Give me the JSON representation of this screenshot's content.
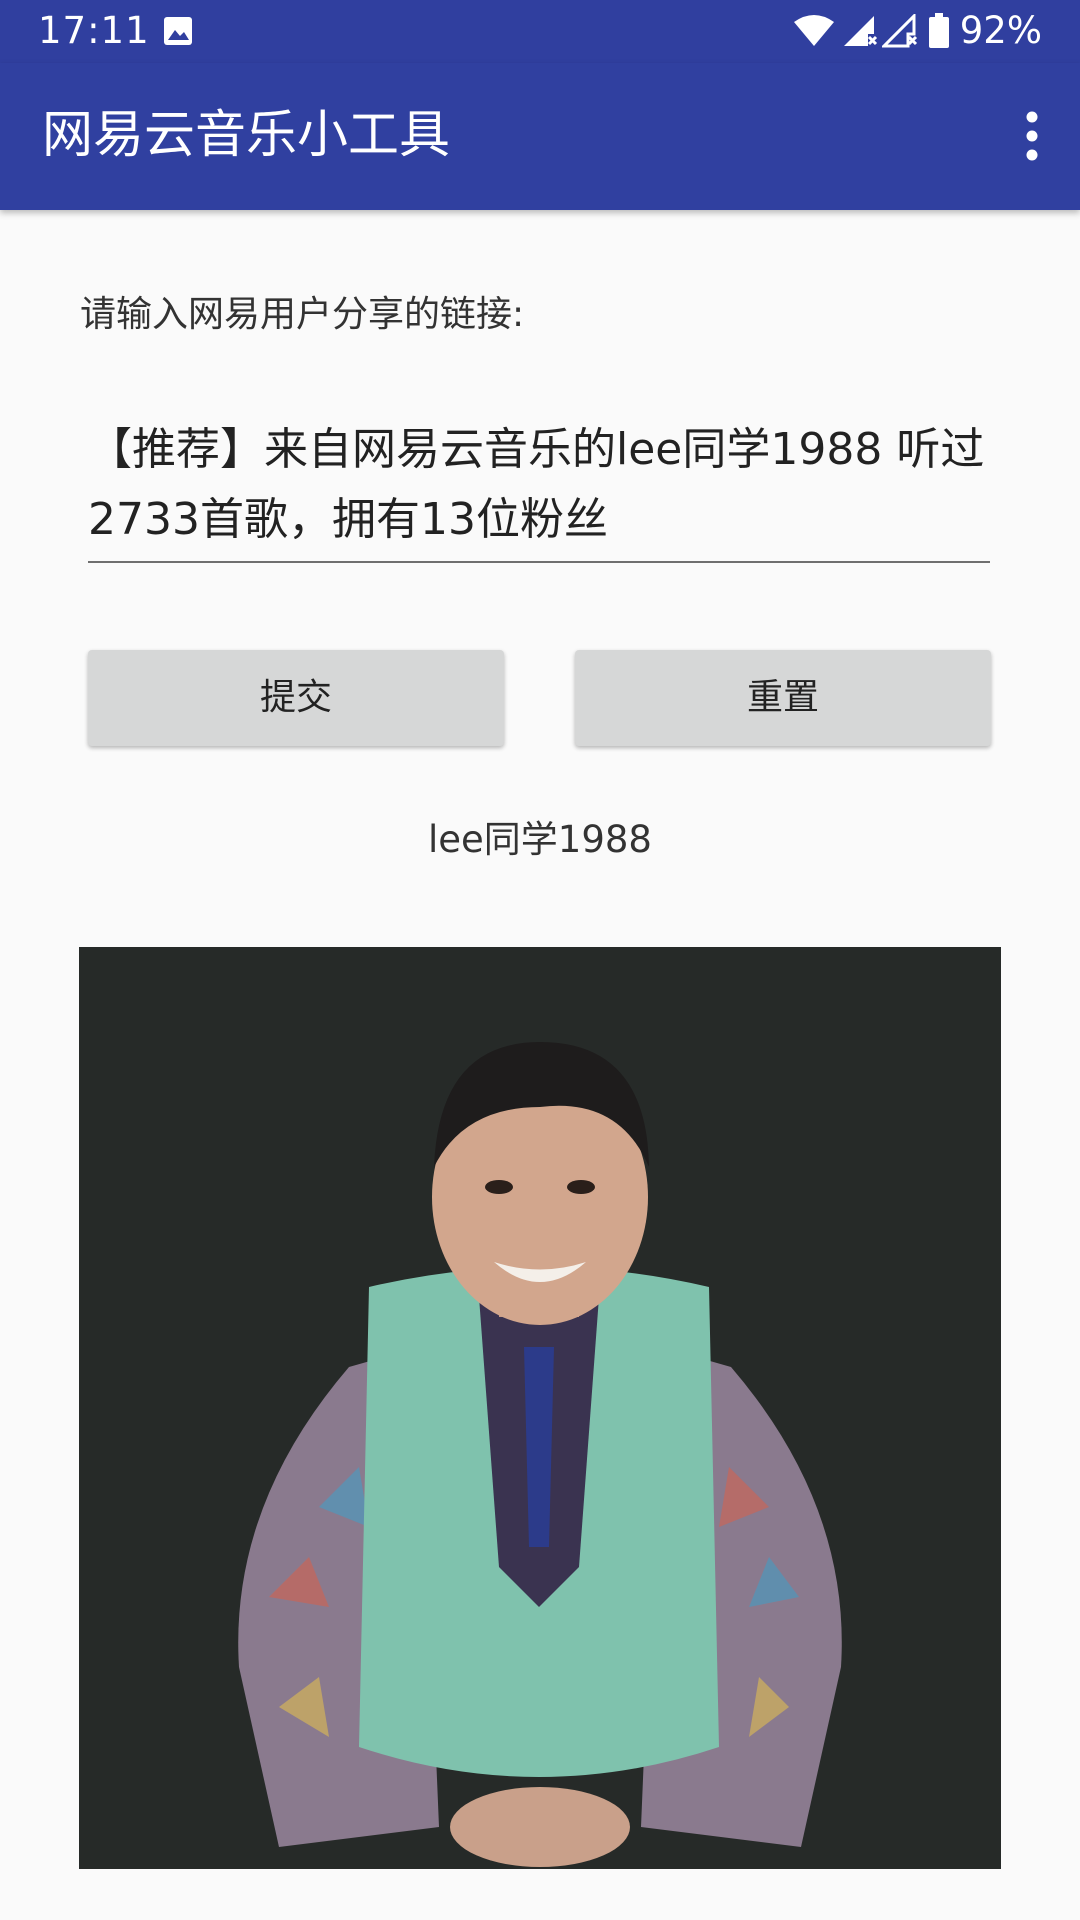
{
  "status_bar": {
    "time": "17:11",
    "battery": "92%",
    "icons": [
      "image-icon",
      "wifi-icon",
      "signal-icon",
      "signal-icon",
      "battery-icon"
    ]
  },
  "toolbar": {
    "title": "网易云音乐小工具",
    "overflow_icon": "more-vert-icon"
  },
  "form": {
    "prompt": "请输入网易用户分享的链接:",
    "input_value": "【推荐】来自网易云音乐的lee同学1988 听过2733首歌，拥有13位粉丝",
    "submit_label": "提交",
    "reset_label": "重置"
  },
  "result": {
    "username": "lee同学1988"
  },
  "colors": {
    "primary": "#3040a0",
    "primary_dark": "#303f9f",
    "button": "#d6d7d7",
    "background": "#fafafa"
  }
}
